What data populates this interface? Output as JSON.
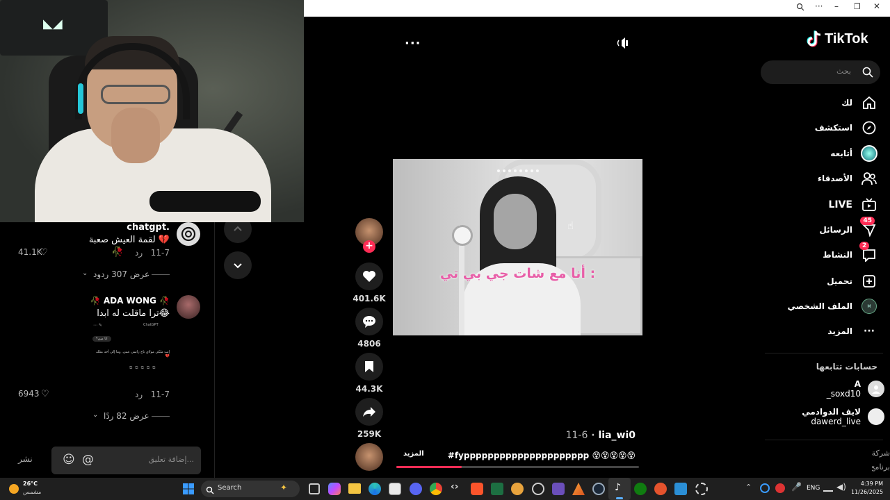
{
  "window": {
    "zoom_icon": "zoom-icon",
    "more_icon": "more-icon",
    "minimize_icon": "minimize-icon",
    "restore_icon": "restore-icon",
    "close_icon": "close-icon"
  },
  "tiktok": {
    "brand": "TikTok",
    "search_placeholder": "بحث",
    "nav": [
      {
        "label": "لك",
        "icon": "home-icon"
      },
      {
        "label": "استكشف",
        "icon": "compass-icon"
      },
      {
        "label": "أتابعه",
        "icon": "following-avatar-icon"
      },
      {
        "label": "الأصدقاء",
        "icon": "friends-icon"
      },
      {
        "label": "LIVE",
        "icon": "live-tv-icon"
      },
      {
        "label": "الرسائل",
        "icon": "send-icon",
        "badge": "45"
      },
      {
        "label": "النشاط",
        "icon": "activity-icon",
        "badge": "2"
      },
      {
        "label": "تحميل",
        "icon": "upload-plus-icon"
      },
      {
        "label": "الملف الشخصي",
        "icon": "profile-avatar-icon"
      },
      {
        "label": "المزيد",
        "icon": "more-dots-icon"
      }
    ],
    "following_title": "حسابات تتابعها",
    "following": [
      {
        "name": "A",
        "handle": "_soxd10"
      },
      {
        "name": "لايف الدوادمي",
        "handle": "dawerd_live"
      }
    ],
    "footer_links": [
      "شركة",
      "برنامج"
    ]
  },
  "video": {
    "caption_overlay": "أنا مع شات جي بي تي :",
    "author": "lia_wi0",
    "date": "11-6",
    "description": "#fyppppppppppppppppppppp 😵😵😵😵😵",
    "more_label": "المزيد",
    "progress": 0.27,
    "likes": "401.6K",
    "comments": "4806",
    "saves": "44.3K",
    "shares": "259K"
  },
  "comments": {
    "items": [
      {
        "author": "chatgpt.",
        "text": "لقمة العيش صعبة 💔",
        "emoji": "🥀",
        "date": "11-7",
        "reply_label": "رد",
        "likes": "41.1K",
        "view_replies": "عرض 307 ردود"
      },
      {
        "author": "🥀 ADA WONG 🥀",
        "text": "ترا ماقلت له ابدا😂",
        "date": "11-7",
        "reply_label": "رد",
        "likes": "6943",
        "view_replies": "عرض 82 ردًا",
        "attachment": {
          "app": "ChatGPT",
          "bubble": "انا مين؟",
          "line": "إنت ملكي مولاي تاج راسي عمي. وما إلي أحد مثلك 💔"
        }
      }
    ],
    "input_placeholder": "إضافة تعليق...",
    "post_label": "نشر"
  },
  "taskbar": {
    "weather_temp": "26°C",
    "weather_desc": "مشمس",
    "search_label": "Search",
    "language": "ENG",
    "time": "4:39 PM",
    "date": "11/26/2025"
  }
}
